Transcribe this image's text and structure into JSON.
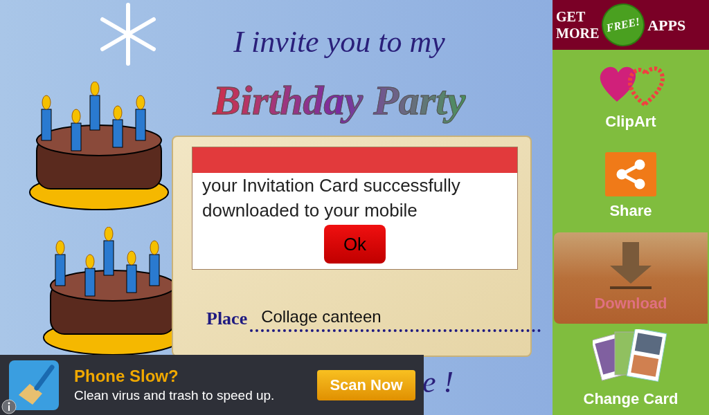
{
  "card": {
    "heading": "I invite you to my",
    "title": "Birthday Party",
    "place_label": "Place",
    "place_value": "Collage canteen",
    "closing_fragment": "e !"
  },
  "dialog": {
    "message": "your Invitation Card successfully downloaded to your mobile",
    "button": "Ok"
  },
  "ad_banner": {
    "headline": "Phone Slow?",
    "text": "Clean virus and trash to speed up.",
    "button": "Scan Now"
  },
  "promo": {
    "left": [
      "GET",
      "MORE"
    ],
    "badge": "FREE!",
    "right": "APPS"
  },
  "sidebar": {
    "items": [
      {
        "kind": "clipart",
        "label": "ClipArt",
        "selected": false
      },
      {
        "kind": "share",
        "label": "Share",
        "selected": false
      },
      {
        "kind": "download",
        "label": "Download",
        "selected": true
      },
      {
        "kind": "cards",
        "label": "Change Card",
        "selected": false
      }
    ]
  }
}
